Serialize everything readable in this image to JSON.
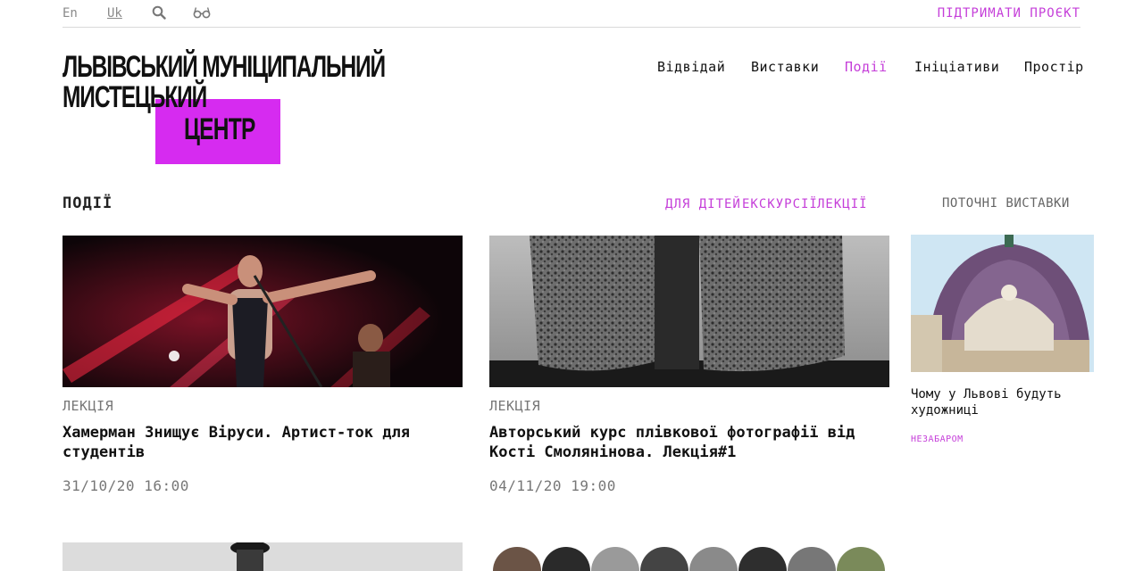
{
  "topbar": {
    "lang_en": "En",
    "lang_uk": "Uk",
    "search_icon": "search-icon",
    "accessibility_icon": "glasses-icon",
    "support_label": "ПІДТРИМАТИ ПРОЄКТ"
  },
  "logo": {
    "line1": "ЛЬВІВСЬКИЙ МУНІЦИПАЛЬНИЙ",
    "line2": "МИСТЕЦЬКИЙ",
    "line3": "ЦЕНТР",
    "accent_color": "#d62bf0"
  },
  "nav": {
    "items": [
      {
        "label": "Відвідай"
      },
      {
        "label": "Виставки"
      },
      {
        "label": "Події",
        "active": true
      },
      {
        "label": "Ініціативи"
      },
      {
        "label": "Простір"
      }
    ]
  },
  "section": {
    "title": "ПОДІЇ",
    "filters": [
      "ДЛЯ ДІТЕЙ",
      "ЕКСКУРСІЇ",
      "ЛЕКЦІЇ"
    ],
    "side_title": "ПОТОЧНІ ВИСТАВКИ"
  },
  "cards": [
    {
      "category": "ЛЕКЦІЯ",
      "title": "Хамерман Знищує Віруси. Артист-ток для студентів",
      "date": "31/10/20 16:00"
    },
    {
      "category": "ЛЕКЦІЯ",
      "title": "Авторський курс плівкової фотографії від Кості Смолянінова. Лекція#1",
      "date": "04/11/20 19:00"
    }
  ],
  "side_card": {
    "title": "Чому у Львові будуть художниці",
    "status": "НЕЗАБАРОМ"
  },
  "colors": {
    "accent": "#c53fd9",
    "brand_box": "#d62bf0",
    "text": "#111111",
    "muted": "#777777"
  }
}
